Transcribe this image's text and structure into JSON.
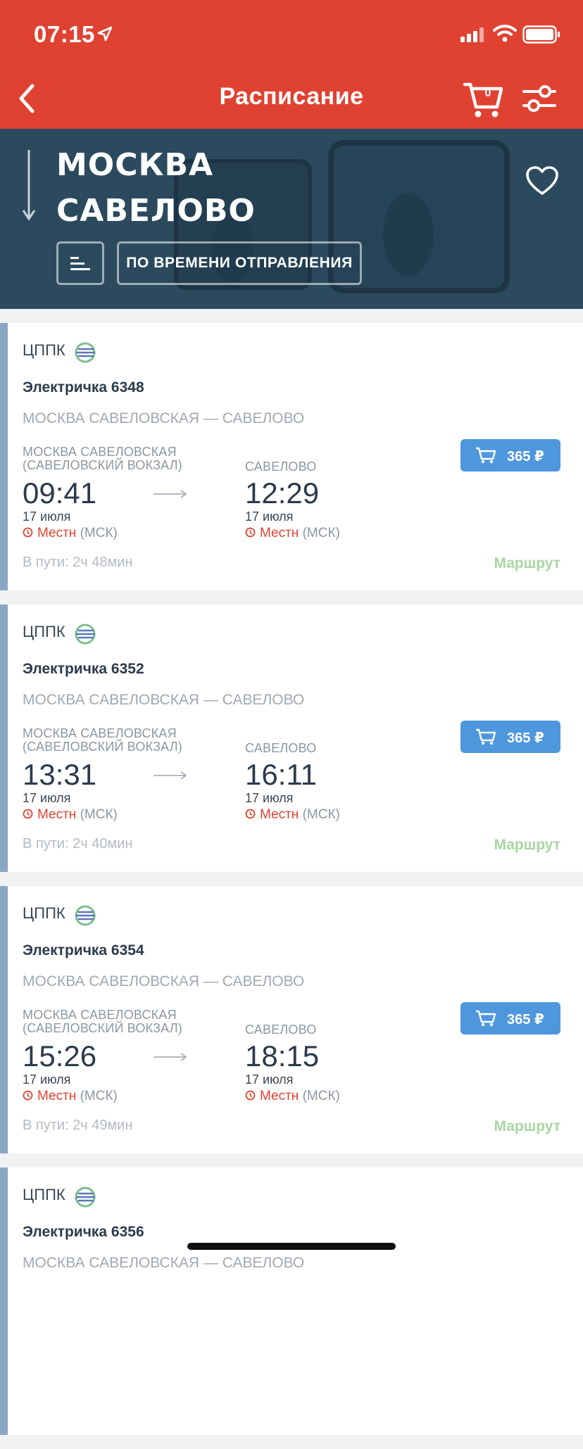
{
  "status_bar": {
    "time": "07:15"
  },
  "header": {
    "title": "Расписание",
    "cart_count": "0"
  },
  "route": {
    "from": "МОСКВА",
    "to": "САВЕЛОВО",
    "sort_label": "ПО ВРЕМЕНИ ОТПРАВЛЕНИЯ"
  },
  "colors": {
    "header_bg": "#e04232",
    "banner_bg": "#2b4a5f",
    "price_button": "#4f97dc",
    "route_link": "#a9d6a2",
    "card_stripe": "#8aa6c4"
  },
  "icons": [
    "back-arrow-icon",
    "cart-icon",
    "filter-sliders-icon",
    "heart-icon",
    "sort-lines-icon",
    "clock-icon",
    "carrier-logo-icon"
  ],
  "trains": [
    {
      "carrier": "ЦППК",
      "name": "Электричка 6348",
      "route": "МОСКВА САВЕЛОВСКАЯ — САВЕЛОВО",
      "dep_station_line1": "МОСКВА САВЕЛОВСКАЯ",
      "dep_station_line2": "(САВЕЛОВСКИЙ ВОКЗАЛ)",
      "dep_time": "09:41",
      "dep_date": "17 июля",
      "arr_station": "САВЕЛОВО",
      "arr_time": "12:29",
      "arr_date": "17 июля",
      "tz_local": "Местн",
      "tz_zone": "(МСК)",
      "duration": "В пути: 2ч 48мин",
      "price": "365 ₽",
      "route_link": "Маршрут"
    },
    {
      "carrier": "ЦППК",
      "name": "Электричка 6352",
      "route": "МОСКВА САВЕЛОВСКАЯ — САВЕЛОВО",
      "dep_station_line1": "МОСКВА САВЕЛОВСКАЯ",
      "dep_station_line2": "(САВЕЛОВСКИЙ ВОКЗАЛ)",
      "dep_time": "13:31",
      "dep_date": "17 июля",
      "arr_station": "САВЕЛОВО",
      "arr_time": "16:11",
      "arr_date": "17 июля",
      "tz_local": "Местн",
      "tz_zone": "(МСК)",
      "duration": "В пути: 2ч 40мин",
      "price": "365 ₽",
      "route_link": "Маршрут"
    },
    {
      "carrier": "ЦППК",
      "name": "Электричка 6354",
      "route": "МОСКВА САВЕЛОВСКАЯ — САВЕЛОВО",
      "dep_station_line1": "МОСКВА САВЕЛОВСКАЯ",
      "dep_station_line2": "(САВЕЛОВСКИЙ ВОКЗАЛ)",
      "dep_time": "15:26",
      "dep_date": "17 июля",
      "arr_station": "САВЕЛОВО",
      "arr_time": "18:15",
      "arr_date": "17 июля",
      "tz_local": "Местн",
      "tz_zone": "(МСК)",
      "duration": "В пути: 2ч 49мин",
      "price": "365 ₽",
      "route_link": "Маршрут"
    },
    {
      "carrier": "ЦППК",
      "name": "Электричка 6356",
      "route": "МОСКВА САВЕЛОВСКАЯ — САВЕЛОВО"
    }
  ]
}
